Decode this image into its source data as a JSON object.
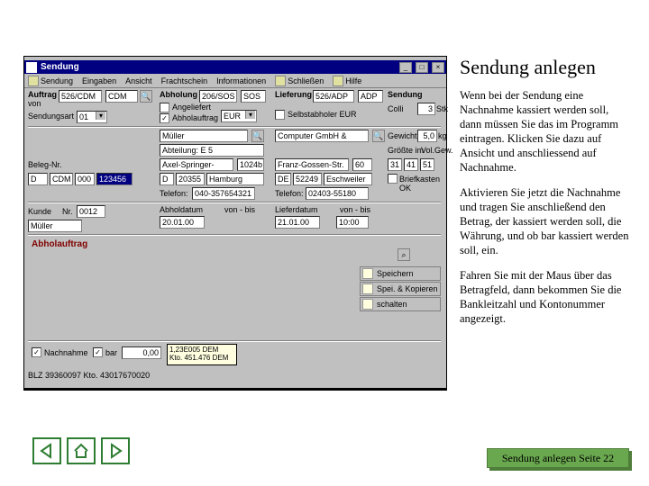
{
  "titlebar": {
    "title": "Sendung"
  },
  "menu": {
    "sendung": "Sendung",
    "eingaben": "Eingaben",
    "ansicht": "Ansicht",
    "frachtschein": "Frachtschein",
    "informationen": "Informationen",
    "schliessen": "Schließen",
    "hilfe": "Hilfe"
  },
  "form": {
    "auftrag_label": "Auftrag",
    "auftrag_von": "von",
    "auftrag_val1": "526/CDM",
    "auftrag_val2": "CDM",
    "abholung_label": "Abholung",
    "abholung_val1": "206/SOS",
    "abholung_val2": "SOS",
    "lieferung_label": "Lieferung",
    "lieferung_val1": "526/ADP",
    "lieferung_val2": "ADP",
    "sendung_label": "Sendung",
    "angeliefert": "Angeliefert",
    "abholauftrag": "Abholauftrag",
    "eur": "EUR",
    "selbstabholer": "Selbstabholer EUR",
    "sendungsart": "Sendungsart",
    "sendungsart_val": "01",
    "colli": "Colli",
    "colli_val": "3",
    "stk": "Stk",
    "name1": "Müller",
    "name2": "Computer GmbH & Co.KG",
    "gewicht": "Gewicht",
    "gewicht_val": "5,0",
    "kg": "kg",
    "abteilung": "Abteilung: E 5",
    "groesste": "Größte im",
    "volgew": "Vol.Gew.",
    "street1": "Axel-Springer-Platz",
    "hnr1": "1024b",
    "street2": "Franz-Gossen-Str.",
    "hnr2": "60",
    "dims1": "31",
    "dims2": "41",
    "dims3": "51",
    "beleg": "Beleg-Nr.",
    "plz_a": "D",
    "plz_b": "CDM",
    "plz_c": "000",
    "plz_d": "123456",
    "plz1_c": "D",
    "plz1": "20355",
    "city1": "Hamburg",
    "plz2_c": "DE",
    "plz2": "52249",
    "city2": "Eschweiler",
    "briefkasten": "Briefkasten OK",
    "telefon1_lbl": "Telefon:",
    "telefon1": "040-357654321",
    "telefon2_lbl": "Telefon:",
    "telefon2": "02403-55180",
    "kunde": "Kunde",
    "kunde_nr_lbl": "Nr.",
    "kunde_nr": "0012",
    "abholdatum_lbl": "Abholdatum",
    "abholdatum": "20.01.00",
    "lieferdatum_lbl": "Lieferdatum",
    "lieferdatum": "21.01.00",
    "vonbis": "von - bis",
    "lief_time": "10:00",
    "kunde_name": "Müller",
    "abholauftrag_head": "Abholauftrag",
    "speichern": "Speichern",
    "spei_kop": "Spei. & Kopieren",
    "schalten": "schalten",
    "nachnahme_lbl": "Nachnahme",
    "bar": "bar",
    "betrag": "0,00",
    "blz_line1": "1,23E005 DEM",
    "blz_line2": "Kto. 451.476 DEM",
    "blz_bottom": "BLZ 39360097 Kto. 43017670020"
  },
  "right": {
    "title": "Sendung anlegen",
    "p1": "Wenn bei der Sendung eine Nachnahme kassiert werden soll, dann müssen Sie das im Programm eintragen. Klicken Sie dazu auf Ansicht und anschliessend auf Nachnahme.",
    "p2": "Aktivieren Sie jetzt die Nachnahme und tragen Sie anschließend den Betrag, der kassiert werden soll, die Währung, und ob bar kassiert werden soll, ein.",
    "p3": "Fahren Sie mit der Maus über das Betragfeld, dann bekommen Sie die Bankleitzahl und Kontonummer angezeigt."
  },
  "footer": {
    "text": "Sendung anlegen Seite 22"
  }
}
